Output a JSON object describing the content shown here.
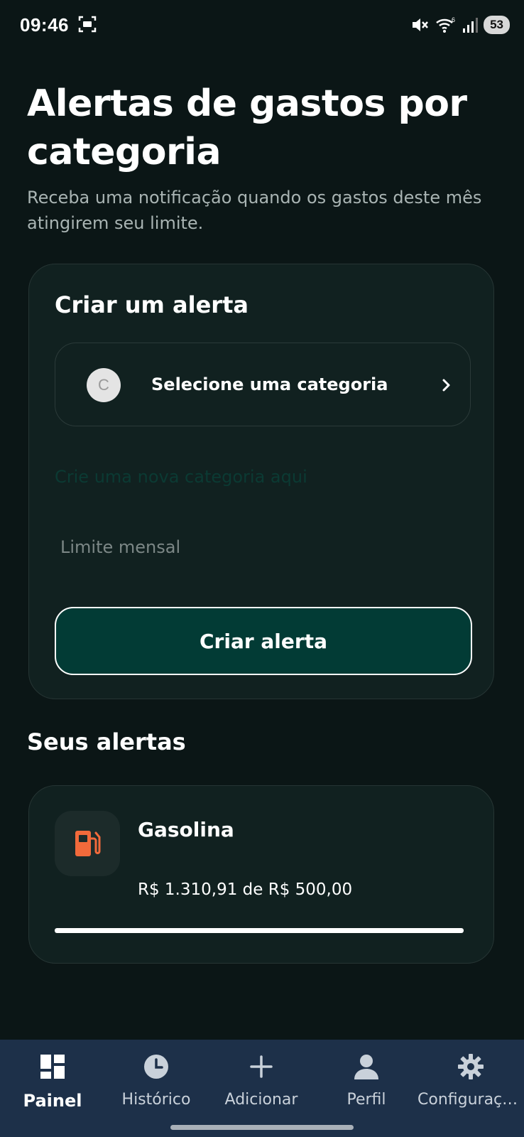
{
  "status_bar": {
    "time": "09:46",
    "battery": "53",
    "icons": [
      "screenshot-icon",
      "mute-icon",
      "wifi-icon",
      "signal-icon",
      "battery-icon"
    ]
  },
  "header": {
    "title": "Alertas de gastos por categoria",
    "subtitle": "Receba uma notificação quando os gastos deste mês atingirem seu limite."
  },
  "create_card": {
    "title": "Criar um alerta",
    "category_avatar_letter": "C",
    "category_placeholder": "Selecione uma categoria",
    "new_category_link": "Crie uma nova categoria aqui",
    "limit_placeholder": "Limite mensal",
    "limit_value": "",
    "create_button": "Criar alerta"
  },
  "alerts_section": {
    "title": "Seus alertas",
    "alerts": [
      {
        "name": "Gasolina",
        "icon": "fuel-pump-icon",
        "icon_color": "#f26a3b",
        "amount_text": "R$ 1.310,91 de R$ 500,00",
        "progress_fraction": 1.0
      }
    ]
  },
  "bottom_nav": {
    "items": [
      {
        "label": "Painel",
        "icon": "dashboard-icon",
        "active": true
      },
      {
        "label": "Histórico",
        "icon": "clock-icon",
        "active": false
      },
      {
        "label": "Adicionar",
        "icon": "plus-icon",
        "active": false
      },
      {
        "label": "Perfil",
        "icon": "person-icon",
        "active": false
      },
      {
        "label": "Configurações",
        "icon": "gear-icon",
        "active": false
      }
    ]
  },
  "colors": {
    "background": "#0b1616",
    "card": "#112120",
    "button": "#023b35",
    "link": "#0b3a33",
    "nav": "#1d3049"
  }
}
